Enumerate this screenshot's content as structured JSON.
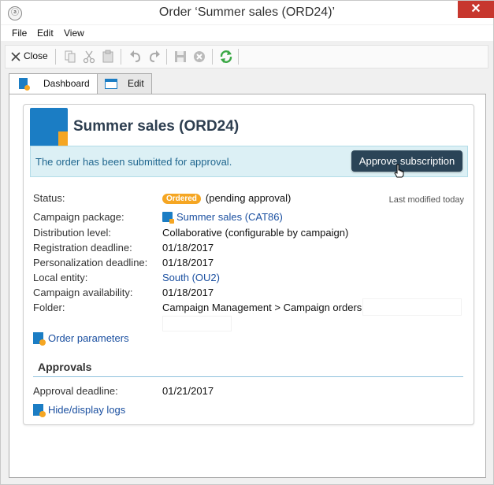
{
  "window": {
    "title": "Order ‘Summer sales (ORD24)’",
    "close_glyph": "✕"
  },
  "menu": {
    "items": [
      "File",
      "Edit",
      "View"
    ]
  },
  "toolbar": {
    "close_label": "Close",
    "icons": [
      "close-icon",
      "copy-icon",
      "cut-icon",
      "paste-icon",
      "undo-icon",
      "redo-icon",
      "save-icon",
      "cancel-icon",
      "refresh-icon"
    ]
  },
  "tabs": [
    {
      "label": "Dashboard",
      "active": true
    },
    {
      "label": "Edit",
      "active": false
    }
  ],
  "order": {
    "title": "Summer sales (ORD24)",
    "banner_text": "The order has been submitted for approval.",
    "approve_button": "Approve subscription",
    "last_modified": "Last modified today",
    "fields": {
      "status_label": "Status:",
      "status_badge": "Ordered",
      "status_value": "(pending approval)",
      "campaign_package_label": "Campaign package:",
      "campaign_package_value": "Summer sales (CAT86)",
      "distribution_label": "Distribution level:",
      "distribution_value": "Collaborative (configurable by campaign)",
      "registration_label": "Registration deadline:",
      "registration_value": "01/18/2017",
      "personalization_label": "Personalization deadline:",
      "personalization_value": "01/18/2017",
      "local_entity_label": "Local entity:",
      "local_entity_value": "South (OU2)",
      "availability_label": "Campaign availability:",
      "availability_value": "01/18/2017",
      "folder_label": "Folder:",
      "folder_value": "Campaign Management > Campaign orders"
    },
    "order_parameters_link": "Order parameters",
    "approvals_title": "Approvals",
    "approval_deadline_label": "Approval deadline:",
    "approval_deadline_value": "01/21/2017",
    "logs_link": "Hide/display logs"
  },
  "colors": {
    "accent": "#1b7dc4",
    "badge": "#f5a623",
    "button_dark": "#2b4457",
    "banner_bg": "#dcf0f5",
    "window_close": "#c7372e"
  }
}
